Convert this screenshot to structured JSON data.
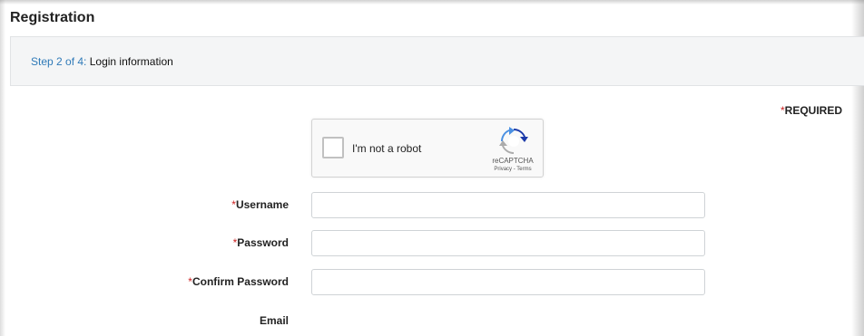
{
  "page": {
    "title": "Registration"
  },
  "step": {
    "prefix": "Step 2 of 4:",
    "label": "Login information"
  },
  "required_note": {
    "star": "*",
    "text": "REQUIRED"
  },
  "captcha": {
    "label": "I'm not a robot",
    "brand": "reCAPTCHA",
    "links": "Privacy - Terms",
    "logo_icon": "recaptcha-logo-icon"
  },
  "form": {
    "fields": [
      {
        "star": "*",
        "label": "Username",
        "value": ""
      },
      {
        "star": "*",
        "label": "Password",
        "value": ""
      },
      {
        "star": "*",
        "label": "Confirm Password",
        "value": ""
      },
      {
        "star": "",
        "label": "Email",
        "value": ""
      }
    ]
  },
  "colors": {
    "accent_link": "#2f7ab8",
    "required_star": "#cc2222",
    "step_bar_bg": "#f4f5f6"
  }
}
